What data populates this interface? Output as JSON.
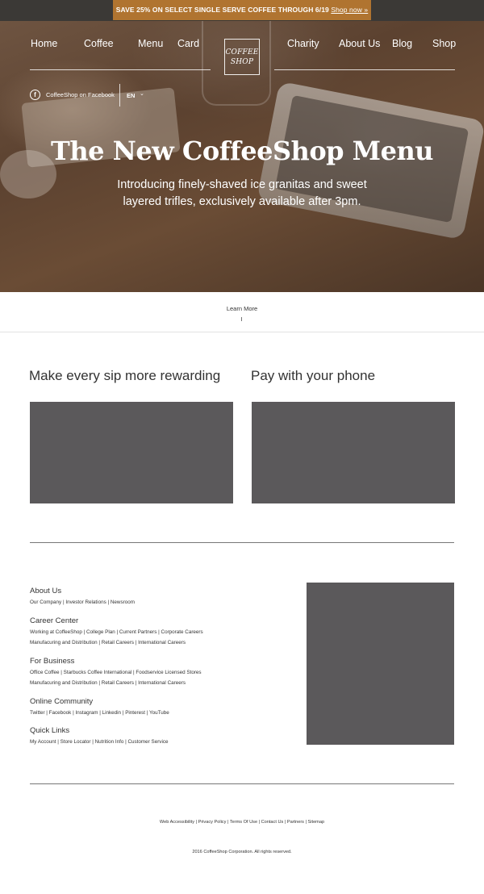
{
  "promo": {
    "text": "SAVE 25% ON SELECT SINGLE SERVE COFFEE THROUGH 6/19",
    "link": "Shop now »"
  },
  "nav": {
    "home": "Home",
    "coffee": "Coffee",
    "menu": "Menu",
    "card": "Card",
    "charity": "Charity",
    "about": "About Us",
    "blog": "Blog",
    "shop": "Shop"
  },
  "logo": {
    "line1": "COFFEE",
    "line2": "SHOP"
  },
  "social": {
    "facebook_icon": "f",
    "facebook_label": "CoffeeShop on Facebook"
  },
  "language": {
    "current": "EN",
    "chevron": "⌄"
  },
  "hero": {
    "title": "The New CoffeeShop Menu",
    "subtitle": "Introducing finely-shaved ice granitas and sweet layered trifles, exclusively available after 3pm."
  },
  "learn_more": "Learn More",
  "features": {
    "rewards_heading": "Make every sip more rewarding",
    "phone_heading": "Pay with your phone"
  },
  "footer": {
    "about": {
      "heading": "About Us",
      "lines": [
        "Our Company | Investor Relations | Newsroom"
      ]
    },
    "career": {
      "heading": "Career Center",
      "lines": [
        "Working at CoffeeShop | College Plan | Current Partners | Corporate Careers",
        "Manufacuring and Distribution | Retail Careers | International Careers"
      ]
    },
    "business": {
      "heading": "For Business",
      "lines": [
        "Office Coffee | Starbucks Coffee International | Foodservice Licensed Stores",
        "Manufacuring and Distribution | Retail Careers | International Careers"
      ]
    },
    "community": {
      "heading": "Online Community",
      "lines": [
        "Twitter | Facebook | Instagram | Linkedin | Pinterest | YouTube"
      ]
    },
    "quick": {
      "heading": "Quick Links",
      "lines": [
        "My Account | Store Locator | Nutrition Info | Customer Service"
      ]
    }
  },
  "legal": "Web Accessibility | Privacy Policy | Terms Of Use | Contact Us | Partners | Sitemap",
  "copyright": "2016 CoffeeShop Corporation. All rights reserved.",
  "colors": {
    "promo_bg": "#b07430",
    "top_strip": "#3b3936",
    "placeholder": "#5b595b"
  }
}
